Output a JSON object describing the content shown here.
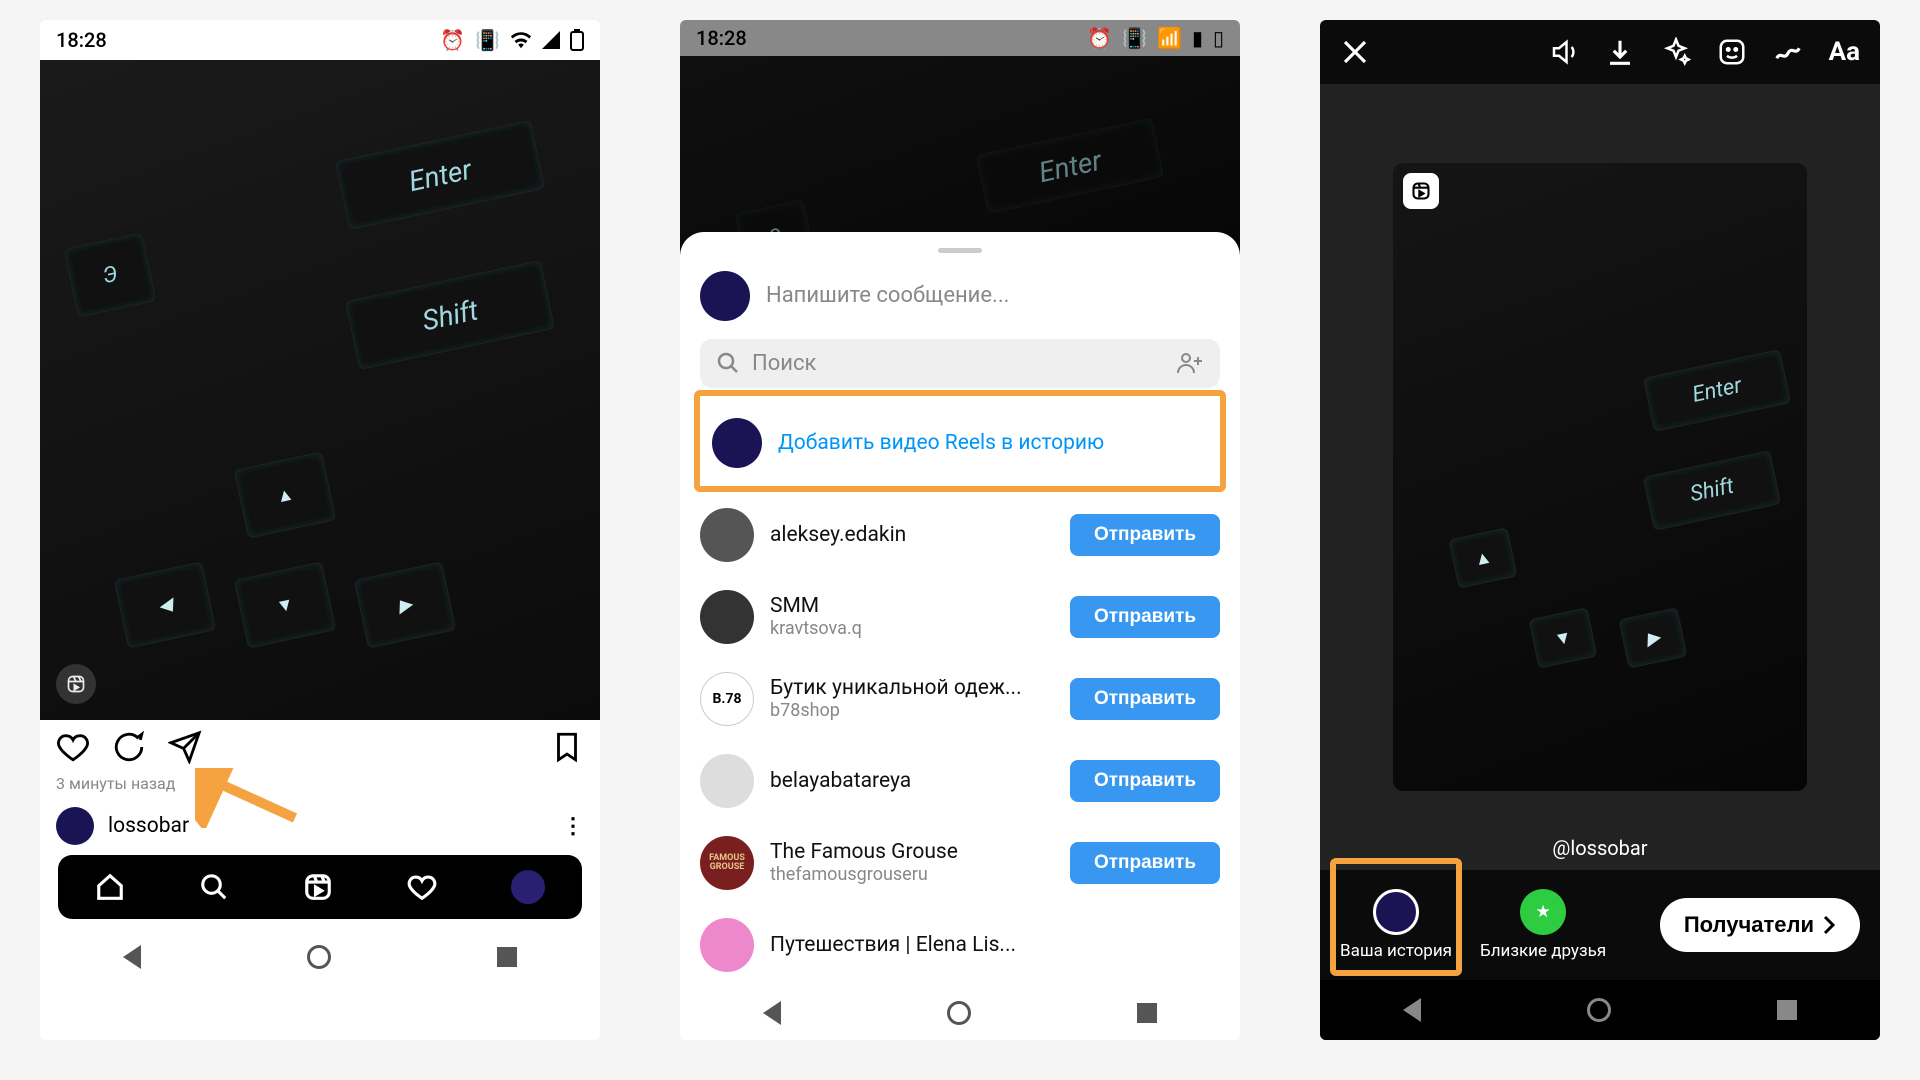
{
  "status": {
    "time": "18:28"
  },
  "post": {
    "timestamp": "3 минуты назад",
    "next_username": "lossobar"
  },
  "share": {
    "message_placeholder": "Напишите сообщение...",
    "search_placeholder": "Поиск",
    "add_to_story": "Добавить видео Reels в историю",
    "send_label": "Отправить",
    "contacts": [
      {
        "name": "aleksey.edakin",
        "sub": ""
      },
      {
        "name": "SMM",
        "sub": "kravtsova.q"
      },
      {
        "name": "Бутик уникальной одеж...",
        "sub": "b78shop",
        "logo": "B.78"
      },
      {
        "name": "belayabatareya",
        "sub": ""
      },
      {
        "name": "The Famous Grouse",
        "sub": "thefamousgrouseru",
        "color": "#7a1f1f"
      },
      {
        "name": "Путешествия | Elena Lis...",
        "sub": ""
      }
    ]
  },
  "story": {
    "handle": "@lossobar",
    "your_story": "Ваша история",
    "close_friends": "Близкие друзья",
    "recipients": "Получатели"
  }
}
